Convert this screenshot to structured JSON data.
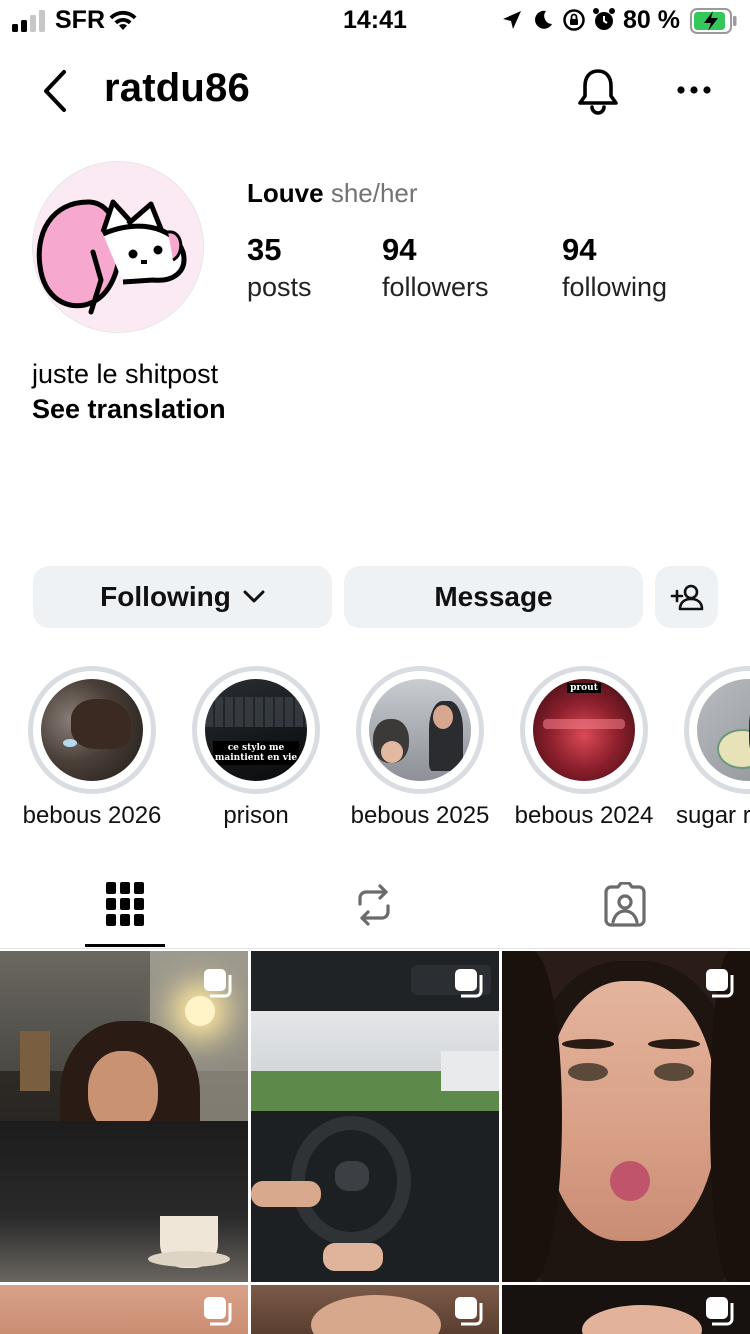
{
  "status_bar": {
    "carrier": "SFR",
    "time": "14:41",
    "battery": "80 %"
  },
  "header": {
    "username": "ratdu86",
    "icons": [
      "back-chevron-icon",
      "bell-icon",
      "more-icon"
    ]
  },
  "profile": {
    "display_name": "Louve",
    "pronouns": "she/her",
    "stats": [
      {
        "value": "35",
        "label": "posts"
      },
      {
        "value": "94",
        "label": "followers"
      },
      {
        "value": "94",
        "label": "following"
      }
    ],
    "bio": "juste le shitpost",
    "see_translation": "See translation"
  },
  "actions": {
    "following_label": "Following",
    "message_label": "Message",
    "add_user_icon": "add-person-icon"
  },
  "highlights": [
    {
      "label": "bebous 2026"
    },
    {
      "label": "prison",
      "caption": "ce stylo me maintient en vie"
    },
    {
      "label": "bebous 2025"
    },
    {
      "label": "bebous 2024",
      "caption": "prout"
    },
    {
      "label": "sugar r"
    }
  ],
  "tabs": [
    "grid-icon",
    "reposts-icon",
    "tagged-icon"
  ],
  "colors": {
    "button_bg": "#eff2f5",
    "highlight_ring": "#d9dde2",
    "secondary_text": "#737373",
    "battery_green": "#34c759"
  }
}
